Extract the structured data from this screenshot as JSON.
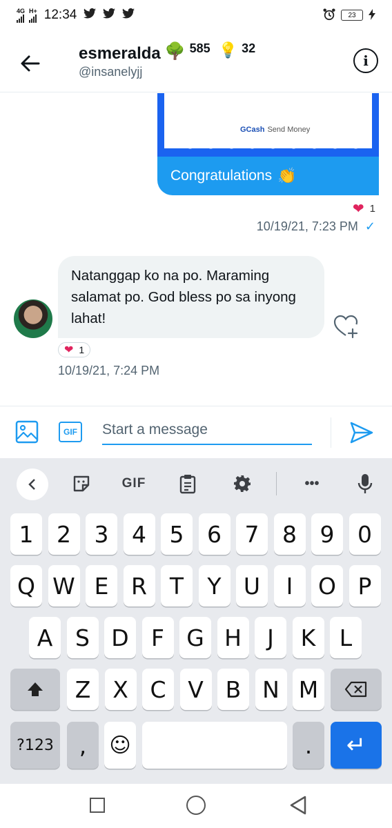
{
  "status_bar": {
    "network_top": "4G",
    "network_top2": "H+",
    "time": "12:34",
    "battery": "23",
    "app_icons": [
      "twitter-icon",
      "twitter-icon",
      "twitter-icon"
    ]
  },
  "header": {
    "name": "esmeralda",
    "tree_emoji": "🌳",
    "tree_count": "585",
    "bulb_emoji": "💡",
    "bulb_count": "32",
    "handle": "@insanelyjj",
    "info_glyph": "i"
  },
  "messages": {
    "card": {
      "brand": "GCash",
      "subtitle": "Send Money"
    },
    "sent": {
      "text": "Congratulations",
      "emoji": "👏",
      "reaction_emoji": "❤",
      "reaction_count": "1",
      "timestamp": "10/19/21, 7:23 PM",
      "status_glyph": "✓"
    },
    "received": {
      "text": "Natanggap ko na po. Maraming salamat po. God bless po sa inyong lahat!",
      "reaction_emoji": "❤",
      "reaction_count": "1",
      "timestamp": "10/19/21, 7:24 PM"
    }
  },
  "composer": {
    "gif_label": "GIF",
    "placeholder": "Start a message"
  },
  "keyboard": {
    "toolbar": {
      "gif_label": "GIF",
      "more_label": "•••"
    },
    "row_numbers": [
      "1",
      "2",
      "3",
      "4",
      "5",
      "6",
      "7",
      "8",
      "9",
      "0"
    ],
    "row_1": [
      "Q",
      "W",
      "E",
      "R",
      "T",
      "Y",
      "U",
      "I",
      "O",
      "P"
    ],
    "row_2": [
      "A",
      "S",
      "D",
      "F",
      "G",
      "H",
      "J",
      "K",
      "L"
    ],
    "row_3": [
      "Z",
      "X",
      "C",
      "V",
      "B",
      "N",
      "M"
    ],
    "bottom": {
      "symbols": "?123",
      "comma": ",",
      "emoji": "☺",
      "period": ".",
      "enter": "↵"
    }
  },
  "colors": {
    "accent": "#1d9bf0",
    "heart": "#e0245e",
    "gcash_blue": "#1a63f0",
    "keyboard_bg": "#e8eaee",
    "enter_key": "#1a73e8"
  }
}
